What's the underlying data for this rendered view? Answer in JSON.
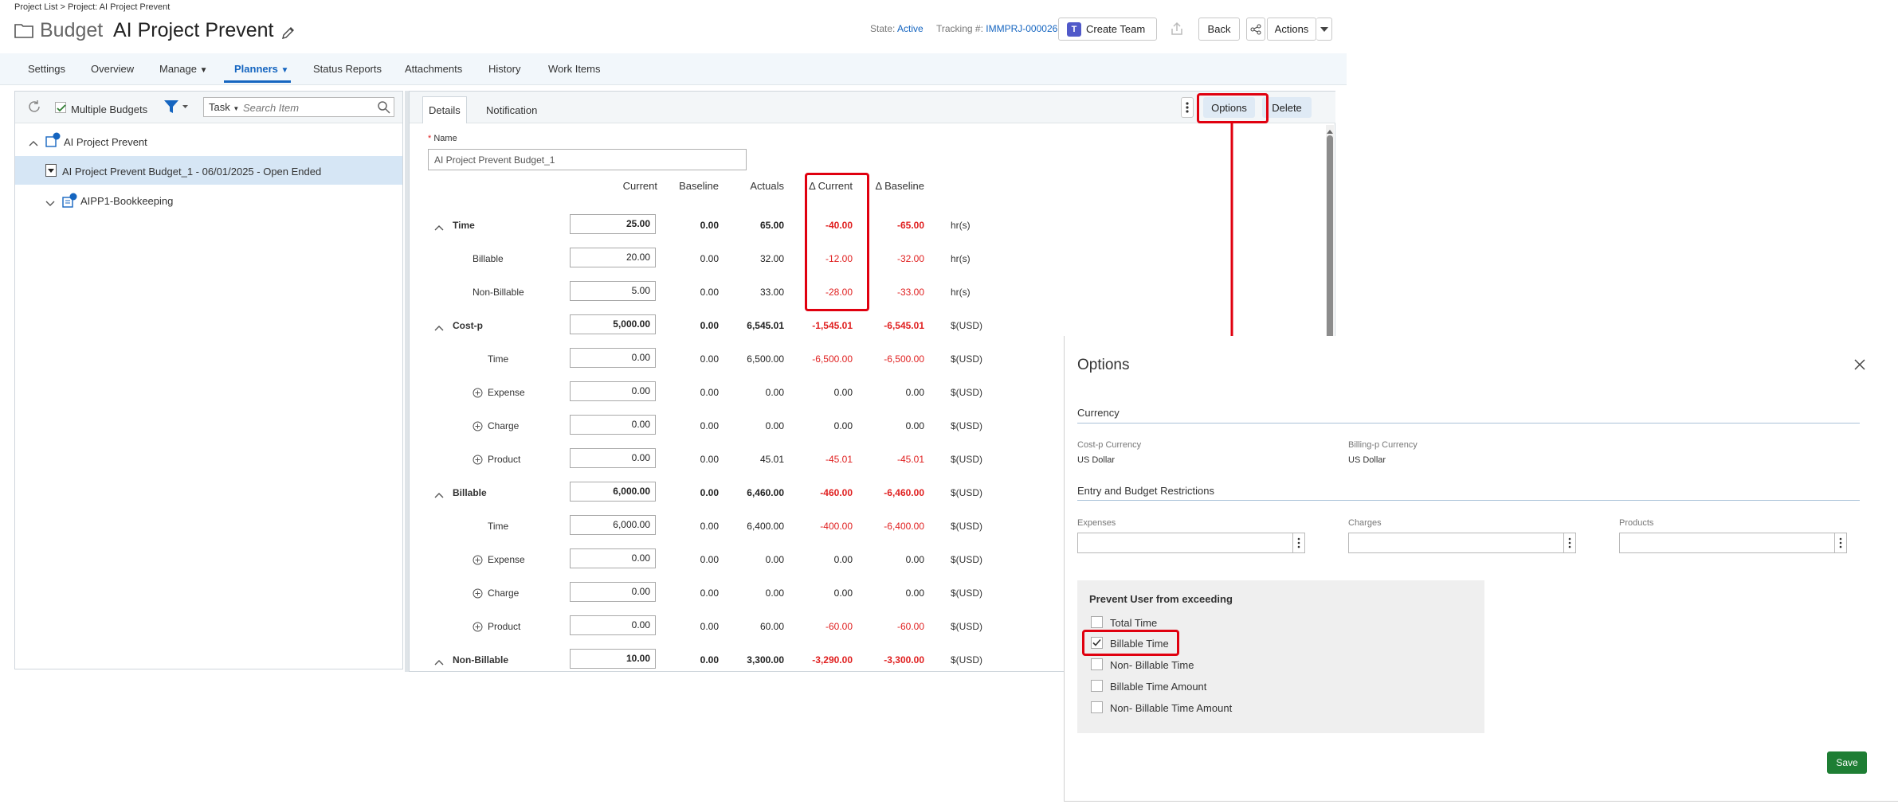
{
  "breadcrumb": "Project List > Project: AI Project Prevent",
  "page": {
    "type_label": "Budget",
    "name": "AI Project Prevent"
  },
  "header": {
    "state_label": "State:",
    "state_value": "Active",
    "tracking_label": "Tracking #:",
    "tracking_value": "IMMPRJ-000026",
    "create_team": "Create Team",
    "back": "Back",
    "actions": "Actions"
  },
  "nav": {
    "settings": "Settings",
    "overview": "Overview",
    "manage": "Manage",
    "planners": "Planners",
    "status_reports": "Status Reports",
    "attachments": "Attachments",
    "history": "History",
    "work_items": "Work Items"
  },
  "left": {
    "multiple_budgets": "Multiple Budgets",
    "filter_type": "Task",
    "search_placeholder": "Search Item",
    "tree": {
      "root": "AI Project Prevent",
      "budget": "AI Project Prevent Budget_1 - 06/01/2025 - Open Ended",
      "child": "AIPP1-Bookkeeping"
    }
  },
  "right": {
    "tabs": {
      "details": "Details",
      "notification": "Notification"
    },
    "options": "Options",
    "delete": "Delete",
    "name_label": "Name",
    "name_value": "AI Project Prevent Budget_1",
    "columns": {
      "current": "Current",
      "baseline": "Baseline",
      "actuals": "Actuals",
      "delta_current": "Δ Current",
      "delta_baseline": "Δ Baseline"
    },
    "rows": [
      {
        "label": "Time",
        "current": "25.00",
        "baseline": "0.00",
        "actuals": "65.00",
        "dcur": "-40.00",
        "dbase": "-65.00",
        "unit": "hr(s)"
      },
      {
        "label": "Billable",
        "current": "20.00",
        "baseline": "0.00",
        "actuals": "32.00",
        "dcur": "-12.00",
        "dbase": "-32.00",
        "unit": "hr(s)"
      },
      {
        "label": "Non-Billable",
        "current": "5.00",
        "baseline": "0.00",
        "actuals": "33.00",
        "dcur": "-28.00",
        "dbase": "-33.00",
        "unit": "hr(s)"
      },
      {
        "label": "Cost-p",
        "current": "5,000.00",
        "baseline": "0.00",
        "actuals": "6,545.01",
        "dcur": "-1,545.01",
        "dbase": "-6,545.01",
        "unit": "$(USD)"
      },
      {
        "label": "Time",
        "current": "0.00",
        "baseline": "0.00",
        "actuals": "6,500.00",
        "dcur": "-6,500.00",
        "dbase": "-6,500.00",
        "unit": "$(USD)"
      },
      {
        "label": "Expense",
        "current": "0.00",
        "baseline": "0.00",
        "actuals": "0.00",
        "dcur": "0.00",
        "dbase": "0.00",
        "unit": "$(USD)"
      },
      {
        "label": "Charge",
        "current": "0.00",
        "baseline": "0.00",
        "actuals": "0.00",
        "dcur": "0.00",
        "dbase": "0.00",
        "unit": "$(USD)"
      },
      {
        "label": "Product",
        "current": "0.00",
        "baseline": "0.00",
        "actuals": "45.01",
        "dcur": "-45.01",
        "dbase": "-45.01",
        "unit": "$(USD)"
      },
      {
        "label": "Billable",
        "current": "6,000.00",
        "baseline": "0.00",
        "actuals": "6,460.00",
        "dcur": "-460.00",
        "dbase": "-6,460.00",
        "unit": "$(USD)"
      },
      {
        "label": "Time",
        "current": "6,000.00",
        "baseline": "0.00",
        "actuals": "6,400.00",
        "dcur": "-400.00",
        "dbase": "-6,400.00",
        "unit": "$(USD)"
      },
      {
        "label": "Expense",
        "current": "0.00",
        "baseline": "0.00",
        "actuals": "0.00",
        "dcur": "0.00",
        "dbase": "0.00",
        "unit": "$(USD)"
      },
      {
        "label": "Charge",
        "current": "0.00",
        "baseline": "0.00",
        "actuals": "0.00",
        "dcur": "0.00",
        "dbase": "0.00",
        "unit": "$(USD)"
      },
      {
        "label": "Product",
        "current": "0.00",
        "baseline": "0.00",
        "actuals": "60.00",
        "dcur": "-60.00",
        "dbase": "-60.00",
        "unit": "$(USD)"
      },
      {
        "label": "Non-Billable",
        "current": "10.00",
        "baseline": "0.00",
        "actuals": "3,300.00",
        "dcur": "-3,290.00",
        "dbase": "-3,300.00",
        "unit": "$(USD)"
      }
    ]
  },
  "dialog": {
    "title": "Options",
    "currency_section": "Currency",
    "costp_label": "Cost-p Currency",
    "costp_value": "US Dollar",
    "billing_label": "Billing-p Currency",
    "billing_value": "US Dollar",
    "restrictions_section": "Entry and Budget Restrictions",
    "expenses": "Expenses",
    "charges": "Charges",
    "products": "Products",
    "prevent_title": "Prevent User from exceeding",
    "checks": [
      "Total Time",
      "Billable Time",
      "Non- Billable Time",
      "Billable Time Amount",
      "Non- Billable Time Amount"
    ],
    "checked_index": 1,
    "save": "Save"
  },
  "colors": {
    "accent": "#1565c0",
    "negative": "#e02020",
    "highlight_box": "#e0000f",
    "save_button": "#1e7e34"
  }
}
